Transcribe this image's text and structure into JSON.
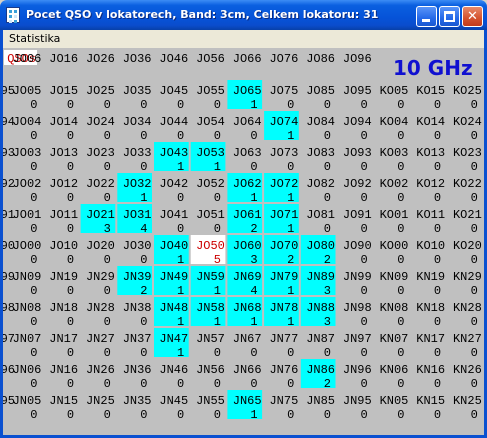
{
  "window": {
    "title": "Pocet QSO v lokatorech,  Band: 3cm,  Celkem lokatoru: 31",
    "icon": "grid-app-icon",
    "controls": [
      "minimize-icon",
      "maximize-icon",
      "close-icon"
    ]
  },
  "menu": {
    "items": [
      "Statistika"
    ]
  },
  "band_label": "10 GHz",
  "corner_label": "QSOs",
  "colors": {
    "highlight": "#00ffff",
    "current_cell": "#ffffff",
    "current_text": "#cc0000",
    "grid_bg": "#c0c0c0",
    "band_label": "#1010d0"
  },
  "rows": [
    {
      "label": "95",
      "cells": [
        [
          "JO05",
          "0"
        ],
        [
          "JO15",
          "0"
        ],
        [
          "JO25",
          "0"
        ],
        [
          "JO35",
          "0"
        ],
        [
          "JO45",
          "0"
        ],
        [
          "JO55",
          "0"
        ],
        [
          "JO65",
          "1",
          1
        ],
        [
          "JO75",
          "0"
        ],
        [
          "JO85",
          "0"
        ],
        [
          "JO95",
          "0"
        ],
        [
          "KO05",
          "0"
        ],
        [
          "KO15",
          "0"
        ],
        [
          "KO25",
          "0"
        ]
      ]
    },
    {
      "label": "94",
      "cells": [
        [
          "JO04",
          "0"
        ],
        [
          "JO14",
          "0"
        ],
        [
          "JO24",
          "0"
        ],
        [
          "JO34",
          "0"
        ],
        [
          "JO44",
          "0"
        ],
        [
          "JO54",
          "0"
        ],
        [
          "JO64",
          "0"
        ],
        [
          "JO74",
          "1",
          1
        ],
        [
          "JO84",
          "0"
        ],
        [
          "JO94",
          "0"
        ],
        [
          "KO04",
          "0"
        ],
        [
          "KO14",
          "0"
        ],
        [
          "KO24",
          "0"
        ]
      ]
    },
    {
      "label": "93",
      "cells": [
        [
          "JO03",
          "0"
        ],
        [
          "JO13",
          "0"
        ],
        [
          "JO23",
          "0"
        ],
        [
          "JO33",
          "0"
        ],
        [
          "JO43",
          "1",
          1
        ],
        [
          "JO53",
          "1",
          1
        ],
        [
          "JO63",
          "0"
        ],
        [
          "JO73",
          "0"
        ],
        [
          "JO83",
          "0"
        ],
        [
          "JO93",
          "0"
        ],
        [
          "KO03",
          "0"
        ],
        [
          "KO13",
          "0"
        ],
        [
          "KO23",
          "0"
        ]
      ]
    },
    {
      "label": "92",
      "cells": [
        [
          "JO02",
          "0"
        ],
        [
          "JO12",
          "0"
        ],
        [
          "JO22",
          "0"
        ],
        [
          "JO32",
          "1",
          1
        ],
        [
          "JO42",
          "0"
        ],
        [
          "JO52",
          "0"
        ],
        [
          "JO62",
          "1",
          1
        ],
        [
          "JO72",
          "1",
          1
        ],
        [
          "JO82",
          "0"
        ],
        [
          "JO92",
          "0"
        ],
        [
          "KO02",
          "0"
        ],
        [
          "KO12",
          "0"
        ],
        [
          "KO22",
          "0"
        ]
      ]
    },
    {
      "label": "91",
      "cells": [
        [
          "JO01",
          "0"
        ],
        [
          "JO11",
          "0"
        ],
        [
          "JO21",
          "3",
          1
        ],
        [
          "JO31",
          "4",
          1
        ],
        [
          "JO41",
          "0"
        ],
        [
          "JO51",
          "0"
        ],
        [
          "JO61",
          "2",
          1
        ],
        [
          "JO71",
          "1",
          1
        ],
        [
          "JO81",
          "0"
        ],
        [
          "JO91",
          "0"
        ],
        [
          "KO01",
          "0"
        ],
        [
          "KO11",
          "0"
        ],
        [
          "KO21",
          "0"
        ]
      ]
    },
    {
      "label": "90",
      "cells": [
        [
          "JO00",
          "0"
        ],
        [
          "JO10",
          "0"
        ],
        [
          "JO20",
          "0"
        ],
        [
          "JO30",
          "0"
        ],
        [
          "JO40",
          "1",
          1
        ],
        [
          "JO50",
          "5",
          2
        ],
        [
          "JO60",
          "3",
          1
        ],
        [
          "JO70",
          "2",
          1
        ],
        [
          "JO80",
          "2",
          1
        ],
        [
          "JO90",
          "0"
        ],
        [
          "KO00",
          "0"
        ],
        [
          "KO10",
          "0"
        ],
        [
          "KO20",
          "0"
        ]
      ]
    },
    {
      "label": "99",
      "cells": [
        [
          "JN09",
          "0"
        ],
        [
          "JN19",
          "0"
        ],
        [
          "JN29",
          "0"
        ],
        [
          "JN39",
          "2",
          1
        ],
        [
          "JN49",
          "1",
          1
        ],
        [
          "JN59",
          "1",
          1
        ],
        [
          "JN69",
          "4",
          1
        ],
        [
          "JN79",
          "1",
          1
        ],
        [
          "JN89",
          "3",
          1
        ],
        [
          "JN99",
          "0"
        ],
        [
          "KN09",
          "0"
        ],
        [
          "KN19",
          "0"
        ],
        [
          "KN29",
          "0"
        ]
      ]
    },
    {
      "label": "98",
      "cells": [
        [
          "JN08",
          "0"
        ],
        [
          "JN18",
          "0"
        ],
        [
          "JN28",
          "0"
        ],
        [
          "JN38",
          "0"
        ],
        [
          "JN48",
          "1",
          1
        ],
        [
          "JN58",
          "1",
          1
        ],
        [
          "JN68",
          "1",
          1
        ],
        [
          "JN78",
          "1",
          1
        ],
        [
          "JN88",
          "3",
          1
        ],
        [
          "JN98",
          "0"
        ],
        [
          "KN08",
          "0"
        ],
        [
          "KN18",
          "0"
        ],
        [
          "KN28",
          "0"
        ]
      ]
    },
    {
      "label": "97",
      "cells": [
        [
          "JN07",
          "0"
        ],
        [
          "JN17",
          "0"
        ],
        [
          "JN27",
          "0"
        ],
        [
          "JN37",
          "0"
        ],
        [
          "JN47",
          "1",
          1
        ],
        [
          "JN57",
          "0"
        ],
        [
          "JN67",
          "0"
        ],
        [
          "JN77",
          "0"
        ],
        [
          "JN87",
          "0"
        ],
        [
          "JN97",
          "0"
        ],
        [
          "KN07",
          "0"
        ],
        [
          "KN17",
          "0"
        ],
        [
          "KN27",
          "0"
        ]
      ]
    },
    {
      "label": "96",
      "cells": [
        [
          "JN06",
          "0"
        ],
        [
          "JN16",
          "0"
        ],
        [
          "JN26",
          "0"
        ],
        [
          "JN36",
          "0"
        ],
        [
          "JN46",
          "0"
        ],
        [
          "JN56",
          "0"
        ],
        [
          "JN66",
          "0"
        ],
        [
          "JN76",
          "0"
        ],
        [
          "JN86",
          "2",
          1
        ],
        [
          "JN96",
          "0"
        ],
        [
          "KN06",
          "0"
        ],
        [
          "KN16",
          "0"
        ],
        [
          "KN26",
          "0"
        ]
      ]
    },
    {
      "label": "95",
      "cells": [
        [
          "JN05",
          "0"
        ],
        [
          "JN15",
          "0"
        ],
        [
          "JN25",
          "0"
        ],
        [
          "JN35",
          "0"
        ],
        [
          "JN45",
          "0"
        ],
        [
          "JN55",
          "0"
        ],
        [
          "JN65",
          "1",
          1
        ],
        [
          "JN75",
          "0"
        ],
        [
          "JN85",
          "0"
        ],
        [
          "JN95",
          "0"
        ],
        [
          "KN05",
          "0"
        ],
        [
          "KN15",
          "0"
        ],
        [
          "KN25",
          "0"
        ]
      ]
    }
  ],
  "header_row": [
    "JO06",
    "JO16",
    "JO26",
    "JO36",
    "JO46",
    "JO56",
    "JO66",
    "JO76",
    "JO86",
    "JO96"
  ]
}
